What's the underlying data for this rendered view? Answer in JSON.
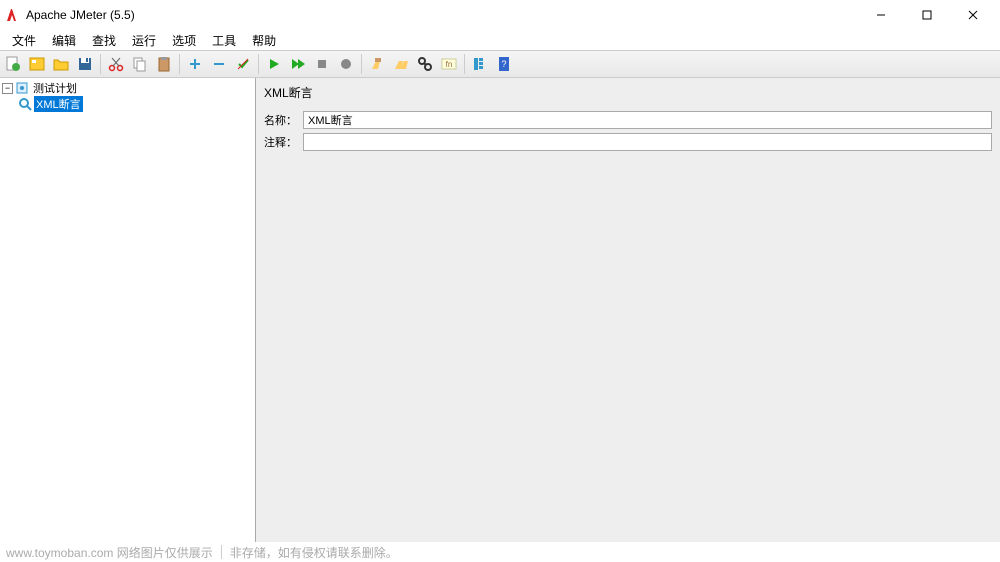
{
  "window": {
    "title": "Apache JMeter (5.5)"
  },
  "menubar": {
    "items": [
      "文件",
      "编辑",
      "查找",
      "运行",
      "选项",
      "工具",
      "帮助"
    ]
  },
  "tree": {
    "root": {
      "label": "测试计划",
      "children": [
        {
          "label": "XML断言",
          "selected": true
        }
      ]
    }
  },
  "content": {
    "title": "XML断言",
    "name_label": "名称：",
    "name_value": "XML断言",
    "comment_label": "注释：",
    "comment_value": ""
  },
  "footer": {
    "left": "www.toymoban.com  网络图片仅供展示",
    "right": "非存储，如有侵权请联系删除。"
  }
}
